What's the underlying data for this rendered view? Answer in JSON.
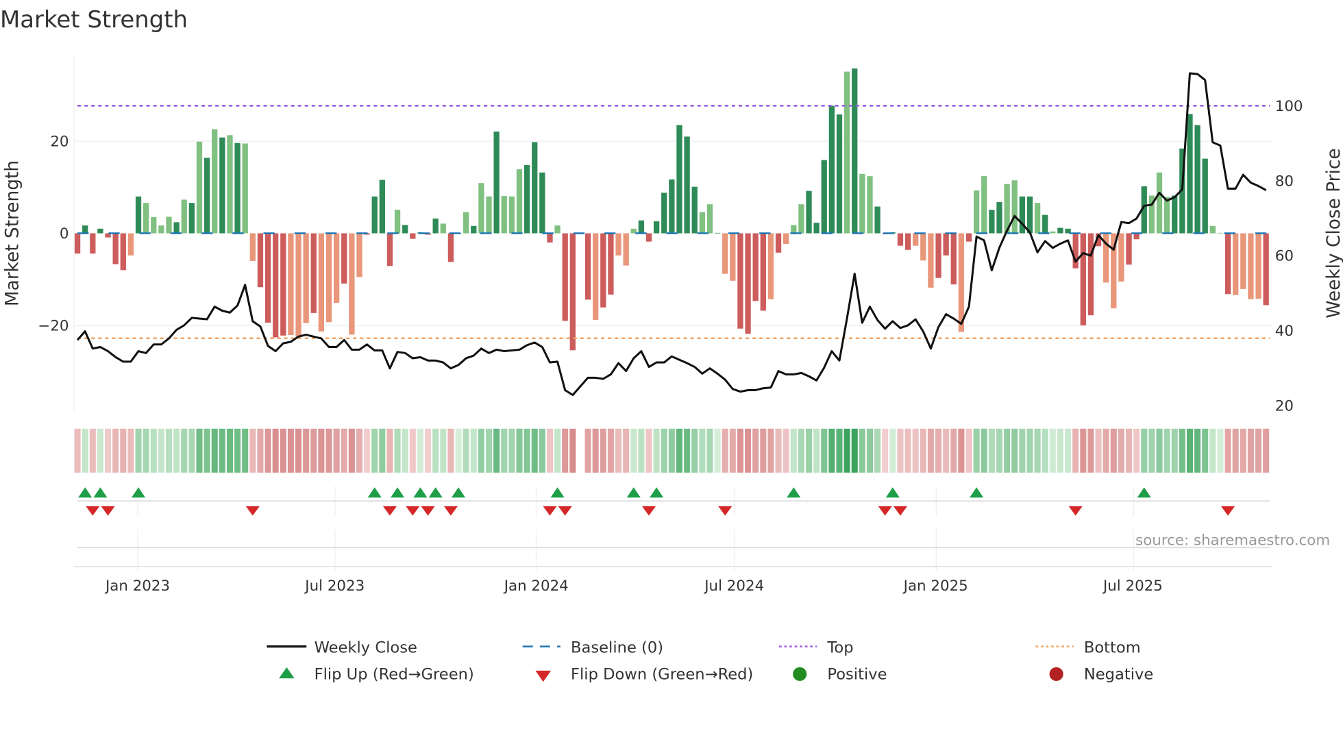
{
  "chart_data": {
    "type": "bar",
    "title": "Market Strength",
    "ylabel": "Market Strength",
    "y2label": "Weekly Close Price",
    "ylim": [
      -39,
      39
    ],
    "y2lim": [
      20,
      110
    ],
    "yticks": [
      "20",
      "0",
      "−20"
    ],
    "y2ticks": [
      "100",
      "80",
      "60",
      "40",
      "20"
    ],
    "xticks": [
      "Jan 2023",
      "Jul 2023",
      "Jan 2024",
      "Jul 2024",
      "Jan 2025",
      "Jul 2025"
    ],
    "xtick_week_index": [
      7.9,
      33.8,
      60.2,
      86.2,
      112.7,
      138.6
    ],
    "top_level": 27.7,
    "bottom_level": -22.8,
    "baseline": 0,
    "strength": [
      -4.4,
      1.7,
      -4.4,
      1.0,
      -0.9,
      -6.7,
      -8.0,
      -4.8,
      8.0,
      6.6,
      3.5,
      1.7,
      3.6,
      2.4,
      7.3,
      6.6,
      19.9,
      16.4,
      22.6,
      20.8,
      21.3,
      19.6,
      19.5,
      -6.0,
      -11.7,
      -19.4,
      -22.6,
      -22.2,
      -22.1,
      -22.4,
      -19.5,
      -17.3,
      -21.3,
      -19.3,
      -15.1,
      -10.9,
      -22.0,
      -9.5,
      -0.3,
      8.0,
      11.6,
      -7.1,
      5.1,
      1.8,
      -1.2,
      0.2,
      -0.3,
      3.2,
      2.1,
      -6.2,
      0,
      4.6,
      1.6,
      10.9,
      8.0,
      22.1,
      8.1,
      8.0,
      13.9,
      14.8,
      19.8,
      13.2,
      -2.0,
      1.7,
      -19.0,
      -25.4,
      null,
      -14.4,
      -18.8,
      -16.1,
      -13.3,
      -4.8,
      -7.0,
      1.0,
      2.8,
      -1.8,
      2.6,
      8.8,
      11.7,
      23.5,
      21.0,
      10.1,
      4.6,
      6.3,
      0.1,
      -8.8,
      -10.3,
      -20.7,
      -21.8,
      -14.7,
      -16.8,
      -14.3,
      -4.2,
      -2.3,
      1.8,
      6.3,
      9.2,
      2.3,
      15.9,
      27.7,
      25.8,
      35.1,
      35.8,
      12.9,
      12.4,
      5.8,
      -0.2,
      0.2,
      -2.7,
      -3.6,
      -2.7,
      -5.9,
      -11.8,
      -9.7,
      -4.8,
      -11.1,
      -21.4,
      -1.8,
      9.3,
      12.4,
      5.1,
      6.8,
      10.7,
      11.5,
      8.0,
      8.0,
      6.6,
      4.0,
      0.4,
      1.2,
      1.0,
      -7.6,
      -20.0,
      -17.8,
      -2.8,
      -10.7,
      -16.3,
      -10.5,
      -6.8,
      -1.3,
      10.2,
      8.2,
      13.2,
      7.9,
      8.2,
      18.4,
      25.9,
      23.5,
      16.2,
      1.6,
      0.1,
      -13.2,
      -13.4,
      -12.1,
      -14.3,
      -14.2,
      -15.6
    ],
    "shade": "dddddddldlllldldldldldllddddllldllldllddddldddddlddldlldlllddddlddddlddlllddddddddlldllddddldllldddddldlldddddllldddldllddllddldlddddddllldddllldddddlldlllldddldllldldddllllddldldd",
    "weekly_close": [
      37.5,
      39.8,
      35.2,
      35.6,
      34.5,
      32.9,
      31.7,
      31.7,
      34.5,
      34.0,
      36.3,
      36.3,
      37.9,
      40.2,
      41.4,
      43.4,
      43.2,
      43.0,
      46.4,
      45.3,
      44.8,
      46.7,
      52.2,
      42.5,
      41.1,
      35.9,
      34.5,
      36.6,
      37.0,
      38.4,
      38.9,
      38.4,
      37.9,
      35.6,
      35.6,
      37.5,
      34.9,
      34.9,
      36.3,
      34.7,
      34.7,
      29.9,
      34.3,
      34.0,
      32.6,
      32.9,
      32.0,
      32.0,
      31.5,
      29.9,
      30.8,
      32.6,
      33.3,
      35.2,
      34.0,
      34.9,
      34.5,
      34.7,
      34.9,
      36.1,
      36.8,
      35.6,
      31.5,
      31.7,
      24.1,
      22.8,
      25.1,
      27.4,
      27.4,
      27.1,
      28.3,
      31.3,
      29.2,
      32.6,
      34.5,
      30.3,
      31.5,
      31.5,
      33.1,
      32.2,
      31.3,
      30.3,
      28.5,
      29.9,
      28.5,
      26.9,
      24.4,
      23.7,
      24.1,
      24.1,
      24.6,
      24.8,
      29.2,
      28.3,
      28.3,
      28.7,
      27.8,
      26.7,
      30.1,
      34.5,
      32.0,
      43.2,
      55.2,
      42.1,
      46.4,
      42.8,
      40.5,
      42.5,
      40.7,
      41.4,
      43.0,
      39.8,
      35.2,
      40.9,
      44.4,
      43.2,
      41.8,
      46.4,
      65.1,
      64.1,
      56.1,
      62.1,
      66.7,
      70.6,
      68.5,
      66.2,
      60.9,
      63.9,
      62.1,
      63.2,
      64.1,
      58.4,
      60.7,
      60.0,
      65.5,
      63.2,
      61.6,
      69.0,
      68.7,
      69.9,
      73.3,
      73.6,
      76.8,
      74.7,
      75.6,
      77.7,
      108.7,
      108.5,
      106.9,
      90.3,
      89.4,
      77.9,
      77.9,
      81.6,
      79.5,
      78.6,
      77.5
    ],
    "flip_up_week_index": [
      1,
      3,
      8,
      39,
      42,
      45,
      47,
      50,
      63,
      73,
      76,
      94,
      107,
      118,
      140
    ],
    "flip_down_week_index": [
      2,
      4,
      23,
      41,
      44,
      46,
      49,
      62,
      64,
      75,
      85,
      106,
      108,
      131,
      151
    ],
    "legend": {
      "placement": "bottom",
      "items": [
        "Weekly Close",
        "Baseline (0)",
        "Top",
        "Bottom",
        "Flip Up (Red→Green)",
        "Flip Down (Green→Red)",
        "Positive",
        "Negative"
      ]
    },
    "colors": {
      "pos_dark": "#2e8b57",
      "pos_light": "#80c080",
      "neg_dark": "#cd5c5c",
      "neg_light": "#e9967a",
      "top": "#9b5de5",
      "bottom": "#f4a460",
      "baseline": "#1f77b4",
      "close": "#111111",
      "flip_up": "#1e9e48",
      "flip_down": "#d62728",
      "positive": "#228b22",
      "negative": "#b22222"
    }
  },
  "source": "source: sharemaestro.com"
}
